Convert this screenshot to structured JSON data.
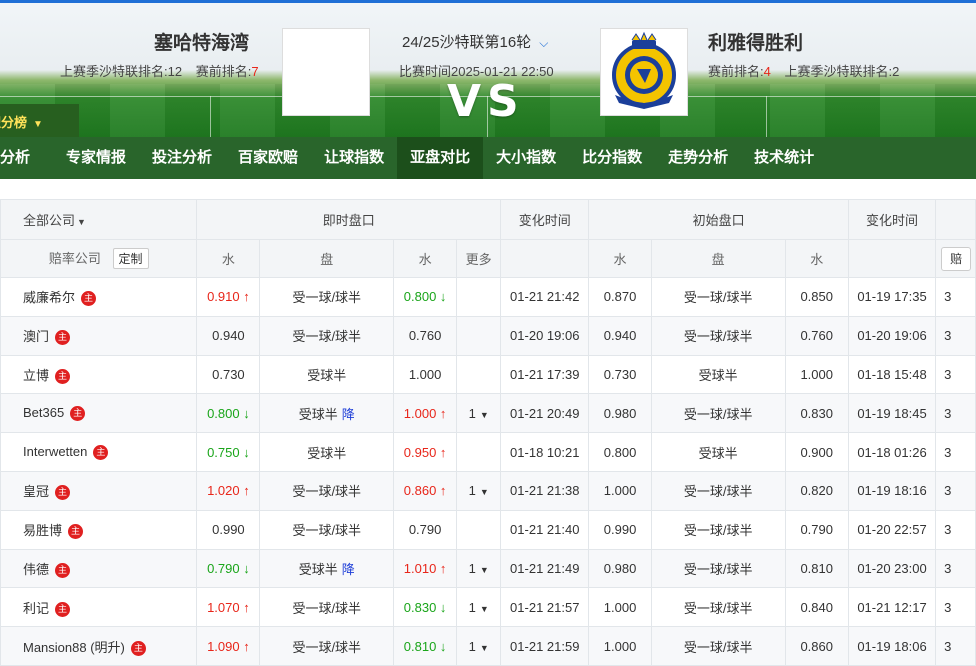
{
  "header": {
    "home_team": "塞哈特海湾",
    "away_team": "利雅得胜利",
    "home_last_season_label": "上赛季沙特联排名:12",
    "home_pre_rank_label": "赛前排名:",
    "home_pre_rank_value": "7",
    "away_pre_rank_label": "赛前排名:",
    "away_pre_rank_value": "4",
    "away_last_season_label": "上赛季沙特联排名:2",
    "match_title": "24/25沙特联第16轮",
    "match_time": "比赛时间2025-01-21 22:50",
    "vs_text": "VS",
    "points_tab": "积分榜",
    "away_logo_text": "AL NASSR"
  },
  "nav": {
    "items": [
      {
        "label": "分析",
        "active": false
      },
      {
        "label": "专家情报",
        "active": false
      },
      {
        "label": "投注分析",
        "active": false
      },
      {
        "label": "百家欧赔",
        "active": false
      },
      {
        "label": "让球指数",
        "active": false
      },
      {
        "label": "亚盘对比",
        "active": true
      },
      {
        "label": "大小指数",
        "active": false
      },
      {
        "label": "比分指数",
        "active": false
      },
      {
        "label": "走势分析",
        "active": false
      },
      {
        "label": "技术统计",
        "active": false
      }
    ]
  },
  "table": {
    "all_companies": "全部公司",
    "live_odds": "即时盘口",
    "change_time": "变化时间",
    "initial_odds": "初始盘口",
    "change_time2": "变化时间",
    "company_col": "赔率公司",
    "custom_btn": "定制",
    "water": "水",
    "handicap": "盘",
    "more": "更多",
    "cut_col": "赔",
    "host_badge": "主",
    "rows": [
      {
        "company": "威廉希尔",
        "live_home": "0.910",
        "live_home_dir": "up",
        "live_line": "受一球/球半",
        "live_drop": "",
        "live_away": "0.800",
        "live_away_dir": "down",
        "more": "",
        "change_time": "01-21 21:42",
        "init_home": "0.870",
        "init_line": "受一球/球半",
        "init_away": "0.850",
        "init_time": "01-19 17:35",
        "cut": "3"
      },
      {
        "company": "澳门",
        "live_home": "0.940",
        "live_home_dir": "",
        "live_line": "受一球/球半",
        "live_drop": "",
        "live_away": "0.760",
        "live_away_dir": "",
        "more": "",
        "change_time": "01-20 19:06",
        "init_home": "0.940",
        "init_line": "受一球/球半",
        "init_away": "0.760",
        "init_time": "01-20 19:06",
        "cut": "3"
      },
      {
        "company": "立博",
        "live_home": "0.730",
        "live_home_dir": "",
        "live_line": "受球半",
        "live_drop": "",
        "live_away": "1.000",
        "live_away_dir": "",
        "more": "",
        "change_time": "01-21 17:39",
        "init_home": "0.730",
        "init_line": "受球半",
        "init_away": "1.000",
        "init_time": "01-18 15:48",
        "cut": "3"
      },
      {
        "company": "Bet365",
        "live_home": "0.800",
        "live_home_dir": "down",
        "live_line": "受球半",
        "live_drop": "降",
        "live_away": "1.000",
        "live_away_dir": "up",
        "more": "1",
        "change_time": "01-21 20:49",
        "init_home": "0.980",
        "init_line": "受一球/球半",
        "init_away": "0.830",
        "init_time": "01-19 18:45",
        "cut": "3"
      },
      {
        "company": "Interwetten",
        "live_home": "0.750",
        "live_home_dir": "down",
        "live_line": "受球半",
        "live_drop": "",
        "live_away": "0.950",
        "live_away_dir": "up",
        "more": "",
        "change_time": "01-18 10:21",
        "init_home": "0.800",
        "init_line": "受球半",
        "init_away": "0.900",
        "init_time": "01-18 01:26",
        "cut": "3"
      },
      {
        "company": "皇冠",
        "live_home": "1.020",
        "live_home_dir": "up",
        "live_line": "受一球/球半",
        "live_drop": "",
        "live_away": "0.860",
        "live_away_dir": "up",
        "more": "1",
        "change_time": "01-21 21:38",
        "init_home": "1.000",
        "init_line": "受一球/球半",
        "init_away": "0.820",
        "init_time": "01-19 18:16",
        "cut": "3"
      },
      {
        "company": "易胜博",
        "live_home": "0.990",
        "live_home_dir": "",
        "live_line": "受一球/球半",
        "live_drop": "",
        "live_away": "0.790",
        "live_away_dir": "",
        "more": "",
        "change_time": "01-21 21:40",
        "init_home": "0.990",
        "init_line": "受一球/球半",
        "init_away": "0.790",
        "init_time": "01-20 22:57",
        "cut": "3"
      },
      {
        "company": "伟德",
        "live_home": "0.790",
        "live_home_dir": "down",
        "live_line": "受球半",
        "live_drop": "降",
        "live_away": "1.010",
        "live_away_dir": "up",
        "more": "1",
        "change_time": "01-21 21:49",
        "init_home": "0.980",
        "init_line": "受一球/球半",
        "init_away": "0.810",
        "init_time": "01-20 23:00",
        "cut": "3"
      },
      {
        "company": "利记",
        "live_home": "1.070",
        "live_home_dir": "up",
        "live_line": "受一球/球半",
        "live_drop": "",
        "live_away": "0.830",
        "live_away_dir": "down",
        "more": "1",
        "change_time": "01-21 21:57",
        "init_home": "1.000",
        "init_line": "受一球/球半",
        "init_away": "0.840",
        "init_time": "01-21 12:17",
        "cut": "3"
      },
      {
        "company": "Mansion88 (明升)",
        "live_home": "1.090",
        "live_home_dir": "up",
        "live_line": "受一球/球半",
        "live_drop": "",
        "live_away": "0.810",
        "live_away_dir": "down",
        "more": "1",
        "change_time": "01-21 21:59",
        "init_home": "1.000",
        "init_line": "受一球/球半",
        "init_away": "0.860",
        "init_time": "01-19 18:06",
        "cut": "3"
      }
    ]
  },
  "colors": {
    "accent_blue": "#1f6fd6",
    "up_red": "#e8261a",
    "down_green": "#1aa51a",
    "nav_green": "#175819",
    "badge_red": "#e02020"
  }
}
